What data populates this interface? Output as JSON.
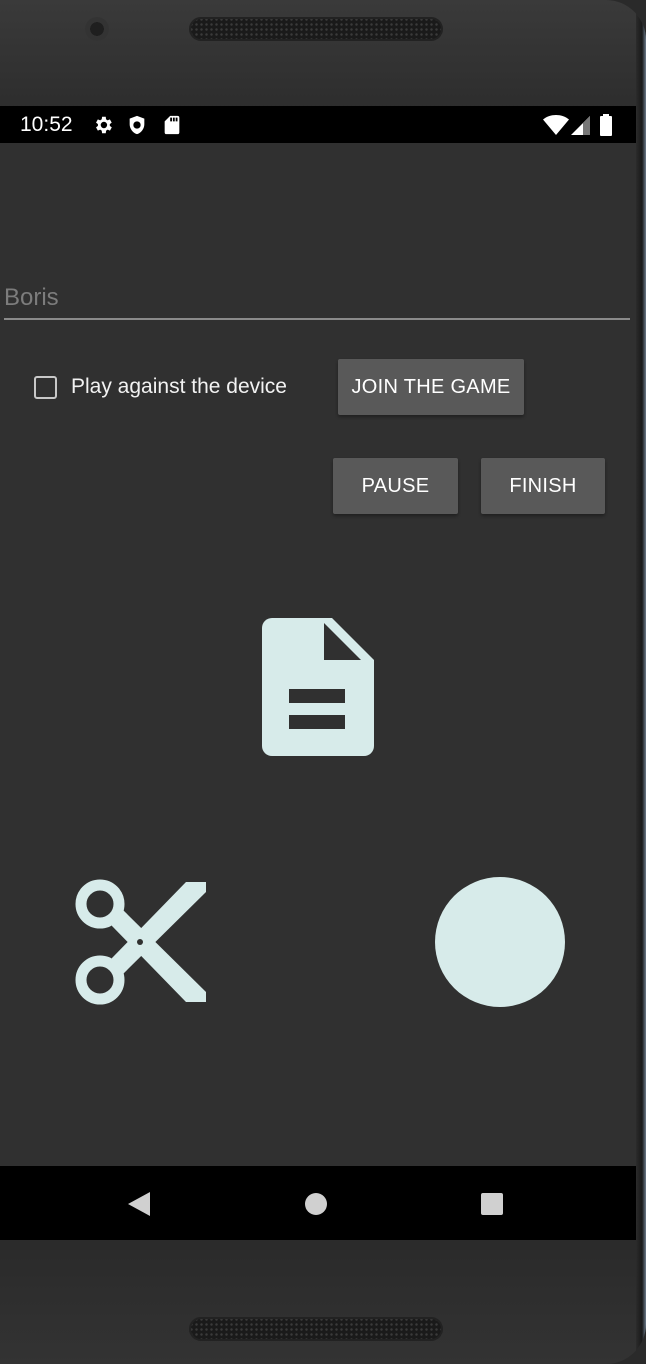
{
  "status_bar": {
    "time": "10:52",
    "icons": [
      "settings-icon",
      "shield-icon",
      "sd-card-icon",
      "wifi-icon",
      "signal-icon",
      "battery-icon"
    ]
  },
  "form": {
    "name_placeholder": "Boris",
    "checkbox_label": "Play against the device",
    "checkbox_checked": false,
    "join_label": "JOIN THE GAME",
    "pause_label": "PAUSE",
    "finish_label": "FINISH"
  },
  "choices": [
    "paper-icon",
    "scissors-icon",
    "rock-icon"
  ],
  "nav_bar": [
    "back-icon",
    "home-icon",
    "recents-icon"
  ],
  "colors": {
    "background": "#303030",
    "button": "#595959",
    "choice_icon": "#d7ebea"
  }
}
